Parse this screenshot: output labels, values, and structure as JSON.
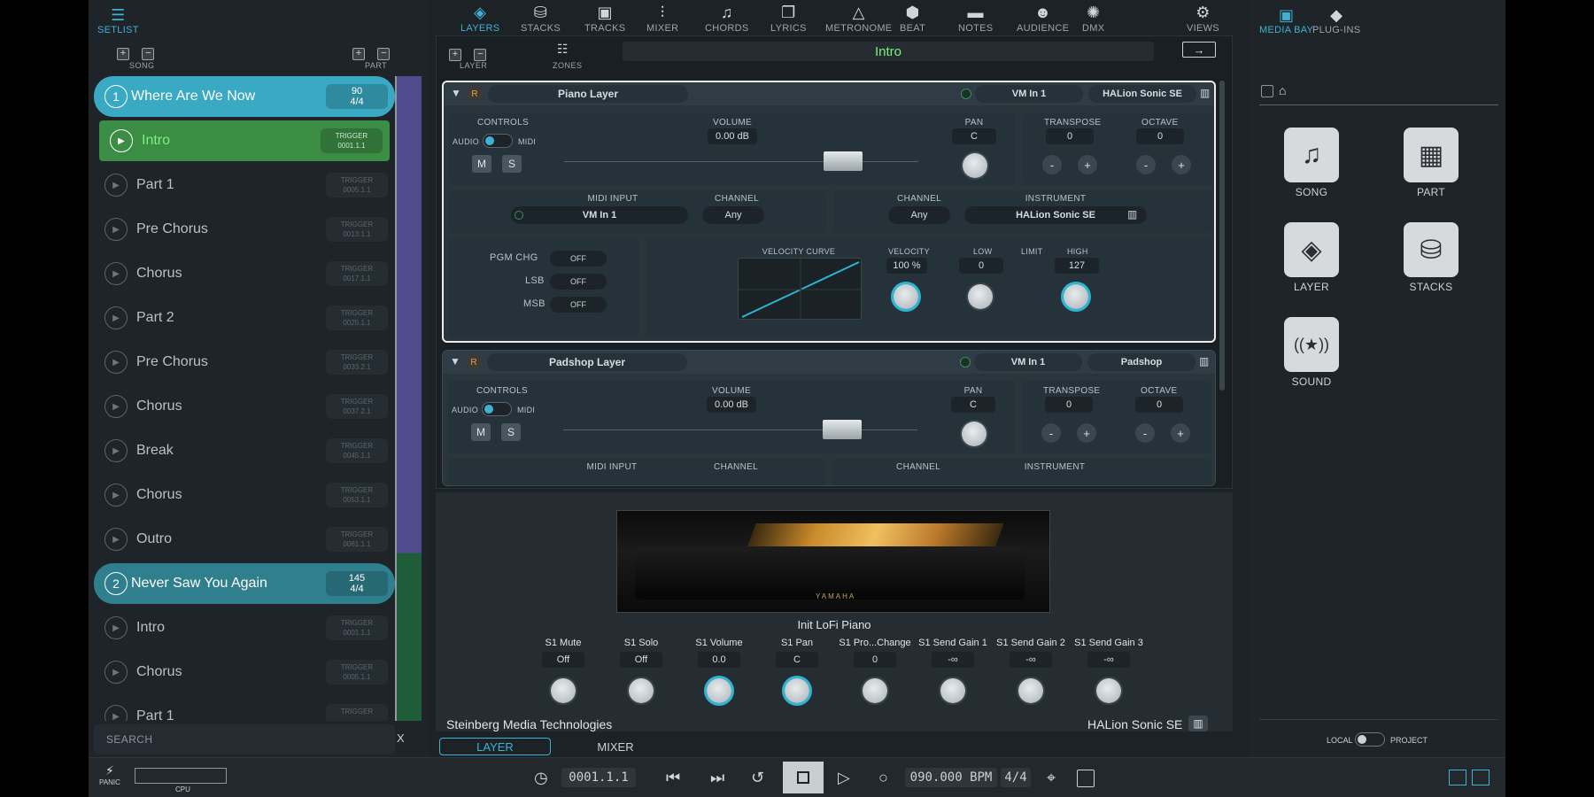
{
  "left_panel": {
    "tab": "SETLIST",
    "song_label": "SONG",
    "part_label": "PART",
    "search_placeholder": "SEARCH",
    "search_clear": "X",
    "rows": [
      {
        "type": "song",
        "num": "1",
        "name": "Where Are We Now",
        "t1": "90",
        "t2": "4/4",
        "color": "#3aa9c4"
      },
      {
        "type": "part",
        "name": "Intro",
        "t1": "TRIGGER",
        "t2": "0001.1.1",
        "active": true
      },
      {
        "type": "part",
        "name": "Part 1",
        "t1": "TRIGGER",
        "t2": "0005.1.1"
      },
      {
        "type": "part",
        "name": "Pre Chorus",
        "t1": "TRIGGER",
        "t2": "0013.1.1"
      },
      {
        "type": "part",
        "name": "Chorus",
        "t1": "TRIGGER",
        "t2": "0017.1.1"
      },
      {
        "type": "part",
        "name": "Part 2",
        "t1": "TRIGGER",
        "t2": "0025.1.1"
      },
      {
        "type": "part",
        "name": "Pre Chorus",
        "t1": "TRIGGER",
        "t2": "0033.2.1"
      },
      {
        "type": "part",
        "name": "Chorus",
        "t1": "TRIGGER",
        "t2": "0037.2.1"
      },
      {
        "type": "part",
        "name": "Break",
        "t1": "TRIGGER",
        "t2": "0045.1.1"
      },
      {
        "type": "part",
        "name": "Chorus",
        "t1": "TRIGGER",
        "t2": "0053.1.1"
      },
      {
        "type": "part",
        "name": "Outro",
        "t1": "TRIGGER",
        "t2": "0061.1.1"
      },
      {
        "type": "song",
        "num": "2",
        "name": "Never Saw You Again",
        "t1": "145",
        "t2": "4/4",
        "color": "#2f7f8e"
      },
      {
        "type": "part",
        "name": "Intro",
        "t1": "TRIGGER",
        "t2": "0001.1.1"
      },
      {
        "type": "part",
        "name": "Chorus",
        "t1": "TRIGGER",
        "t2": "0005.1.1"
      },
      {
        "type": "part",
        "name": "Part 1",
        "t1": "TRIGGER",
        "t2": ""
      }
    ]
  },
  "top_tabs": [
    {
      "label": "LAYERS",
      "icon": "layers-icon",
      "glyph": "◈",
      "active": true
    },
    {
      "label": "STACKS",
      "icon": "stacks-icon",
      "glyph": "⛁"
    },
    {
      "label": "TRACKS",
      "icon": "tracks-icon",
      "glyph": "▣"
    },
    {
      "label": "MIXER",
      "icon": "mixer-icon",
      "glyph": "⫶"
    },
    {
      "label": "CHORDS",
      "icon": "chords-icon",
      "glyph": "♫"
    },
    {
      "label": "LYRICS",
      "icon": "lyrics-icon",
      "glyph": "❐"
    },
    {
      "label": "METRONOME",
      "icon": "metronome-icon",
      "glyph": "△"
    },
    {
      "label": "BEAT",
      "icon": "beat-icon",
      "glyph": "⬢"
    },
    {
      "label": "NOTES",
      "icon": "notes-icon",
      "glyph": "▬"
    },
    {
      "label": "AUDIENCE",
      "icon": "audience-icon",
      "glyph": "☻"
    },
    {
      "label": "DMX",
      "icon": "dmx-icon",
      "glyph": "✺"
    },
    {
      "label": "VIEWS",
      "icon": "views-icon",
      "glyph": "⚙"
    }
  ],
  "center": {
    "layer_label": "LAYER",
    "zones_label": "ZONES",
    "current_part": "Intro",
    "layers": [
      {
        "name": "Piano Layer",
        "rec": "R",
        "midi_in": "VM In 1",
        "instrument": "HALion Sonic SE",
        "controls": "CONTROLS",
        "audio": "AUDIO",
        "midi": "MIDI",
        "mute": "M",
        "solo": "S",
        "volume_label": "VOLUME",
        "volume": "0.00 dB",
        "pan_label": "PAN",
        "pan": "C",
        "transpose_label": "TRANSPOSE",
        "transpose": "0",
        "octave_label": "OCTAVE",
        "octave": "0",
        "minus": "-",
        "plus": "+",
        "midi_input_label": "MIDI INPUT",
        "channel_label": "CHANNEL",
        "midi_input": "VM In 1",
        "channel": "Any",
        "out_channel_label": "CHANNEL",
        "out_channel": "Any",
        "instrument_label": "INSTRUMENT",
        "instrument_sel": "HALion Sonic SE",
        "pgm_label": "PGM CHG",
        "lsb_label": "LSB",
        "msb_label": "MSB",
        "off": "OFF",
        "vel_curve_label": "VELOCITY CURVE",
        "velocity_label": "VELOCITY",
        "velocity": "100 %",
        "low_label": "LOW",
        "low": "0",
        "limit_label": "LIMIT",
        "high_label": "HIGH",
        "high": "127"
      },
      {
        "name": "Padshop Layer",
        "rec": "R",
        "midi_in": "VM In 1",
        "instrument": "Padshop",
        "controls": "CONTROLS",
        "audio": "AUDIO",
        "midi": "MIDI",
        "mute": "M",
        "solo": "S",
        "volume_label": "VOLUME",
        "volume": "0.00 dB",
        "pan_label": "PAN",
        "pan": "C",
        "transpose_label": "TRANSPOSE",
        "transpose": "0",
        "octave_label": "OCTAVE",
        "octave": "0",
        "minus": "-",
        "plus": "+",
        "midi_input_label": "MIDI INPUT",
        "channel_label": "CHANNEL",
        "out_channel_label": "CHANNEL",
        "instrument_label": "INSTRUMENT"
      }
    ]
  },
  "instrument_panel": {
    "preset": "Init LoFi Piano",
    "brand": "YAMAHA",
    "params": [
      {
        "label": "S1 Mute",
        "value": "Off"
      },
      {
        "label": "S1 Solo",
        "value": "Off"
      },
      {
        "label": "S1 Volume",
        "value": "0.0",
        "cyan": true
      },
      {
        "label": "S1 Pan",
        "value": "C",
        "cyan": true
      },
      {
        "label": "S1 Pro...Change",
        "value": "0"
      },
      {
        "label": "S1 Send Gain 1",
        "value": "-∞"
      },
      {
        "label": "S1 Send Gain 2",
        "value": "-∞"
      },
      {
        "label": "S1 Send Gain 3",
        "value": "-∞"
      }
    ],
    "vendor": "Steinberg Media Technologies",
    "plugin": "HALion Sonic SE",
    "tab_layer": "LAYER",
    "tab_mixer": "MIXER"
  },
  "transport": {
    "panic": "PANIC",
    "cpu": "CPU",
    "position": "0001.1.1",
    "tempo": "090.000 BPM",
    "signature": "4/4"
  },
  "right_panel": {
    "tab_media": "MEDIA BAY",
    "tab_plugins": "PLUG-INS",
    "tiles": [
      {
        "label": "SONG",
        "glyph": "♫",
        "icon": "song-icon"
      },
      {
        "label": "PART",
        "glyph": "▦",
        "icon": "part-icon"
      },
      {
        "label": "LAYER",
        "glyph": "◈",
        "icon": "layer-icon"
      },
      {
        "label": "STACKS",
        "glyph": "⛁",
        "icon": "stacks-icon"
      },
      {
        "label": "SOUND",
        "glyph": "((★))",
        "icon": "sound-icon"
      }
    ],
    "local": "LOCAL",
    "project": "PROJECT"
  },
  "colors": {
    "accent": "#3fb2d4",
    "active_green": "#7df07d",
    "part_green": "#3b8c45"
  }
}
